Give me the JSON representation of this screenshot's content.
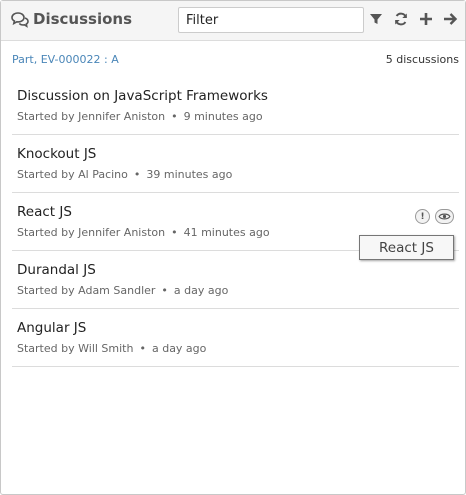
{
  "header": {
    "title": "Discussions",
    "title_icon": "comments-icon",
    "filter_placeholder": "Filter",
    "tools": [
      "filter-icon",
      "refresh-icon",
      "plus-icon",
      "arrow-right-icon"
    ]
  },
  "context": {
    "parent": "Part, EV-000022 : A",
    "count": "5 discussions"
  },
  "discussions": [
    {
      "title": "Discussion on JavaScript Frameworks",
      "prefix": "Started by",
      "author": "Jennifer Aniston",
      "time": "9 minutes ago"
    },
    {
      "title": "Knockout JS",
      "prefix": "Started by",
      "author": "Al Pacino",
      "time": "39 minutes ago"
    },
    {
      "title": "React JS",
      "prefix": "Started by",
      "author": "Jennifer Aniston",
      "time": "41 minutes ago",
      "actions": [
        "exclamation-icon",
        "eye-icon"
      ]
    },
    {
      "title": "Durandal JS",
      "prefix": "Started by",
      "author": "Adam Sandler",
      "time": "a day ago"
    },
    {
      "title": "Angular JS",
      "prefix": "Started by",
      "author": "Will Smith",
      "time": "a day ago"
    }
  ],
  "separator": "•",
  "tooltip": {
    "text": "React JS"
  },
  "colors": {
    "link": "#4a86b8",
    "header_bg": "#f5f5f5",
    "border": "#dcdcdc"
  }
}
